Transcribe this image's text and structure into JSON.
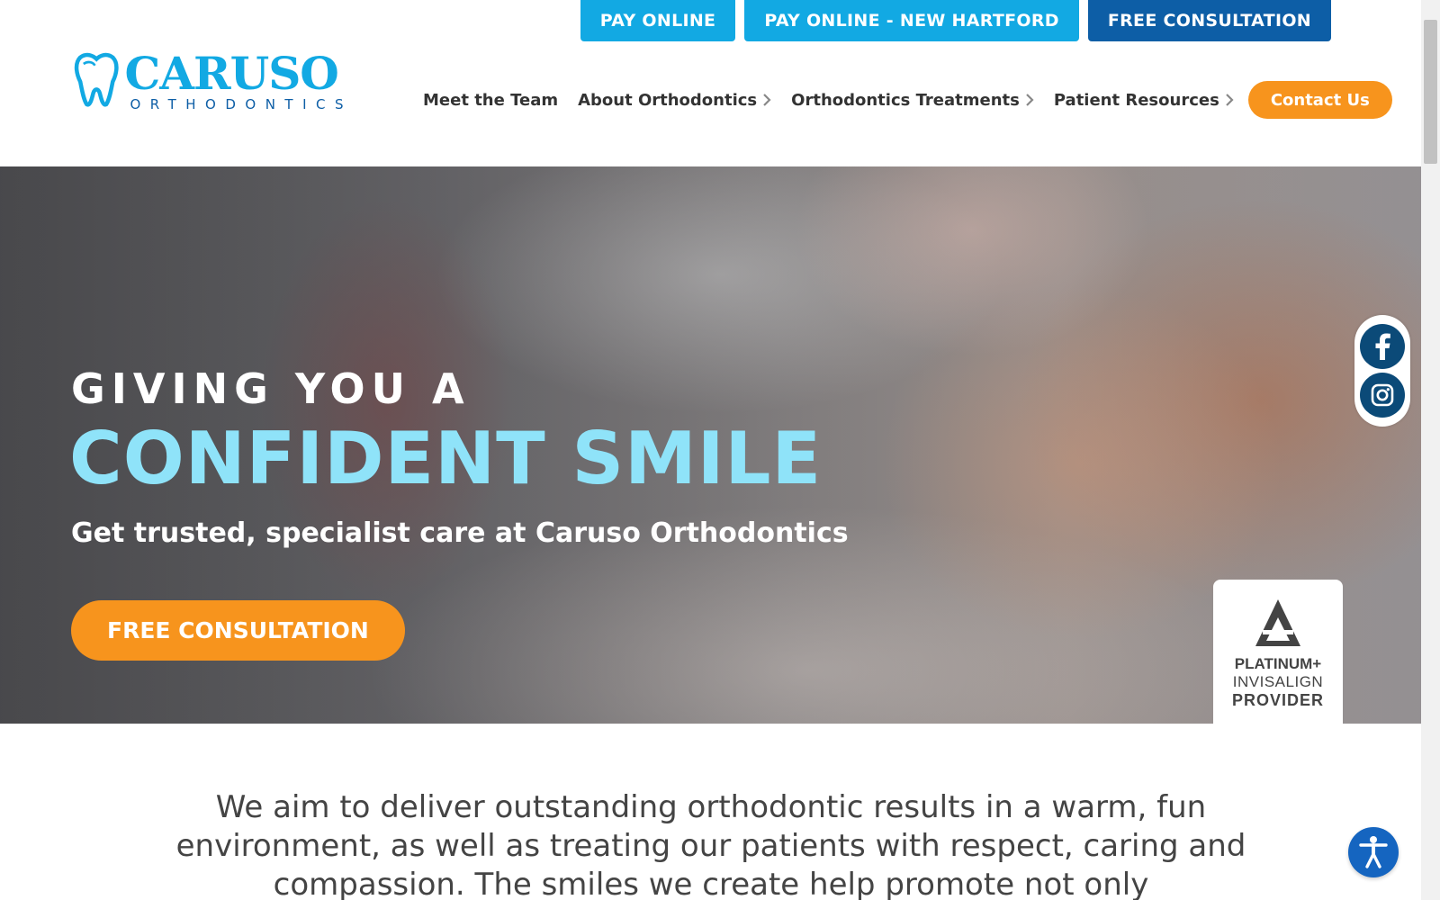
{
  "topbar": {
    "pay_online": "PAY ONLINE",
    "pay_online_nh": "PAY ONLINE - NEW HARTFORD",
    "free_consultation": "FREE CONSULTATION"
  },
  "logo": {
    "main": "CARUSO",
    "sub": "ORTHODONTICS"
  },
  "nav": {
    "items": [
      {
        "label": "Meet the Team",
        "has_submenu": false
      },
      {
        "label": "About Orthodontics",
        "has_submenu": true
      },
      {
        "label": "Orthodontics Treatments",
        "has_submenu": true
      },
      {
        "label": "Patient Resources",
        "has_submenu": true
      }
    ],
    "contact": "Contact Us"
  },
  "hero": {
    "kicker": "GIVING YOU A",
    "title": "CONFIDENT SMILE",
    "subtitle": "Get trusted, specialist care at Caruso Orthodontics",
    "cta": "FREE CONSULTATION",
    "badge": {
      "line1": "PLATINUM+",
      "line2": "INVISALIGN",
      "line3": "PROVIDER"
    }
  },
  "social": {
    "icons": [
      "facebook-icon",
      "instagram-icon"
    ]
  },
  "mission": {
    "text": "We aim to deliver outstanding orthodontic results in a warm, fun environment, as well as treating our patients with respect, caring and compassion. The smiles we create help promote not only"
  },
  "colors": {
    "brand_light": "#12a9e3",
    "brand_dark": "#0d5ea6",
    "accent_orange": "#f7941d",
    "hero_title": "#8fe3f9",
    "social_bg": "#0b4a78"
  }
}
